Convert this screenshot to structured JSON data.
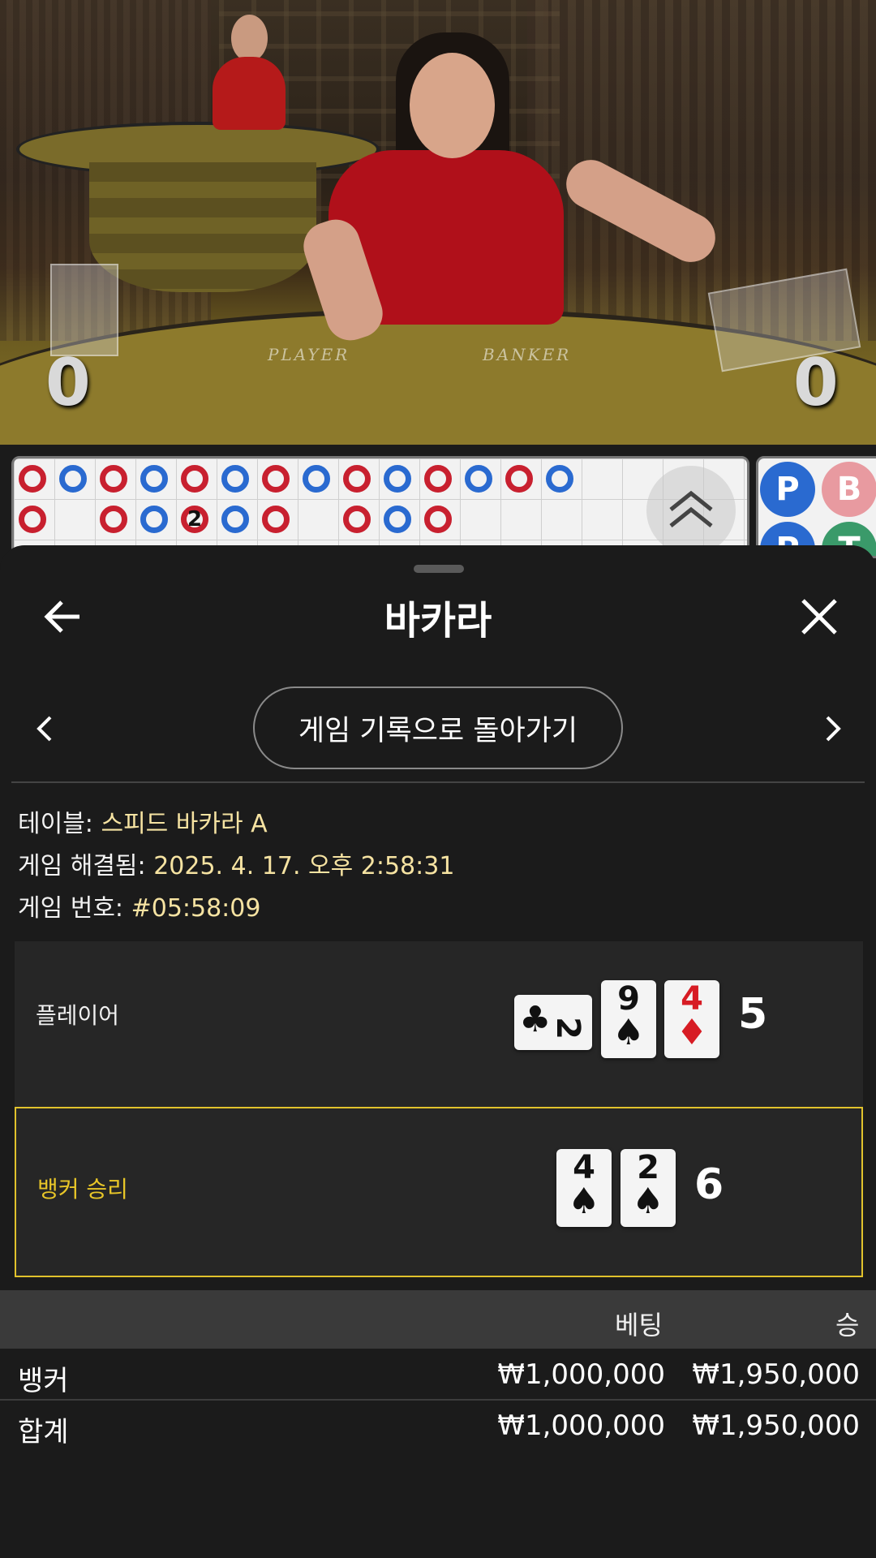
{
  "video": {
    "table_text_left": "PLAYER",
    "table_text_right": "BANKER",
    "player_score": "0",
    "banker_score": "0"
  },
  "roadmap": {
    "marker": "2",
    "p_label": "P",
    "b_label": "B",
    "t_label": "T"
  },
  "header": {
    "title": "바카라"
  },
  "back_history_label": "게임 기록으로 돌아가기",
  "details": {
    "table_label": "테이블:",
    "table_value": "스피드 바카라 A",
    "resolved_label": "게임 해결됨:",
    "resolved_value": "2025. 4. 17. 오후 2:58:31",
    "game_no_label": "게임 번호:",
    "game_no_value": "#05:58:09"
  },
  "player_hand": {
    "label": "플레이어",
    "total": "5",
    "cards": [
      {
        "rank": "2",
        "suit": "♣",
        "color": "black",
        "sideways": true
      },
      {
        "rank": "9",
        "suit": "♠",
        "color": "black"
      },
      {
        "rank": "4",
        "suit": "♦",
        "color": "red"
      }
    ]
  },
  "banker_hand": {
    "label": "뱅커 승리",
    "total": "6",
    "cards": [
      {
        "rank": "4",
        "suit": "♠",
        "color": "black"
      },
      {
        "rank": "2",
        "suit": "♠",
        "color": "black"
      }
    ]
  },
  "bets_table": {
    "col_bet": "베팅",
    "col_win": "승",
    "rows": [
      {
        "name": "뱅커",
        "bet": "₩1,000,000",
        "win": "₩1,950,000"
      },
      {
        "name": "합계",
        "bet": "₩1,000,000",
        "win": "₩1,950,000"
      }
    ]
  },
  "colors": {
    "banker_red": "#c8202f",
    "player_blue": "#2a6ad0",
    "win_highlight": "#e1c22c",
    "info_value": "#f6e3a2"
  }
}
